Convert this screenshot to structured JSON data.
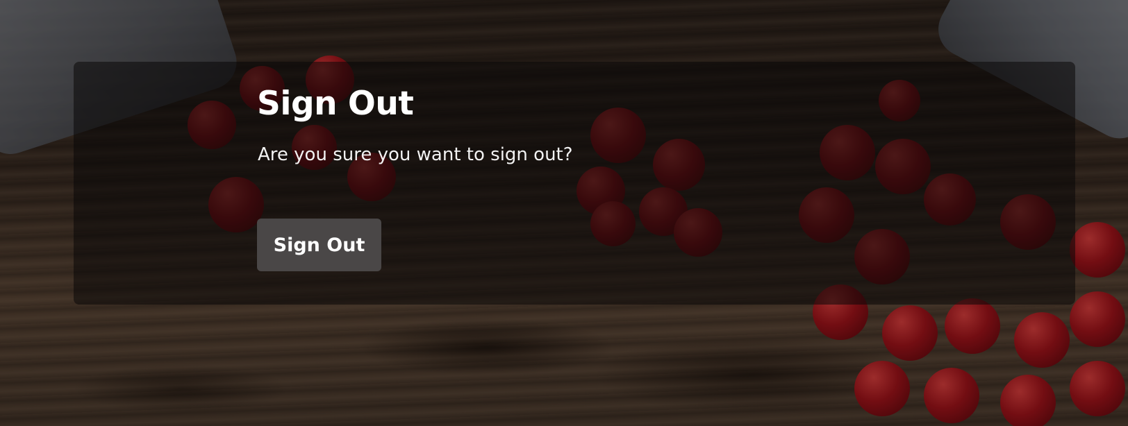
{
  "dialog": {
    "title": "Sign Out",
    "message": "Are you sure you want to sign out?",
    "confirm_label": "Sign Out"
  },
  "colors": {
    "card_overlay": "#0a0808",
    "button_bg": "#4a4747",
    "text": "#ffffff",
    "berry": "#a5141b"
  }
}
